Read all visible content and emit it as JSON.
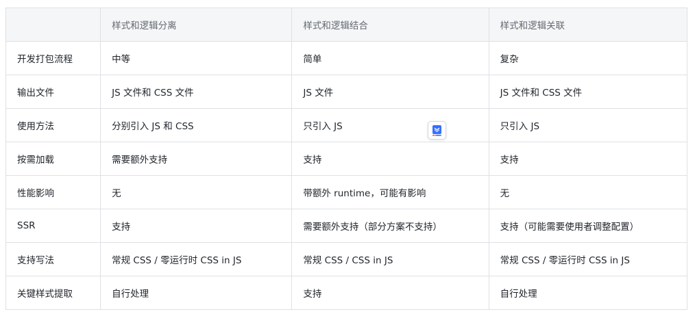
{
  "columns": [
    "",
    "样式和逻辑分离",
    "样式和逻辑结合",
    "样式和逻辑关联"
  ],
  "rows": [
    {
      "label": "开发打包流程",
      "values": [
        "中等",
        "简单",
        "复杂"
      ]
    },
    {
      "label": "输出文件",
      "values": [
        "JS 文件和 CSS 文件",
        "JS 文件",
        "JS 文件和 CSS 文件"
      ]
    },
    {
      "label": "使用方法",
      "values": [
        "分别引入 JS 和 CSS",
        "只引入 JS",
        "只引入 JS"
      ]
    },
    {
      "label": "按需加载",
      "values": [
        "需要额外支持",
        "支持",
        "支持"
      ]
    },
    {
      "label": "性能影响",
      "values": [
        "无",
        "带额外 runtime，可能有影响",
        "无"
      ]
    },
    {
      "label": "SSR",
      "values": [
        "支持",
        "需要额外支持（部分方案不支持）",
        "支持（可能需要使用者调整配置）"
      ]
    },
    {
      "label": "支持写法",
      "values": [
        "常规 CSS / 零运行时 CSS in JS",
        "常规 CSS / CSS in JS",
        "常规 CSS / 零运行时 CSS in JS"
      ]
    },
    {
      "label": "关键样式提取",
      "values": [
        "自行处理",
        "支持",
        "自行处理"
      ]
    }
  ],
  "floating_icon": {
    "name": "document-app-icon",
    "accent": "#3370ff"
  }
}
